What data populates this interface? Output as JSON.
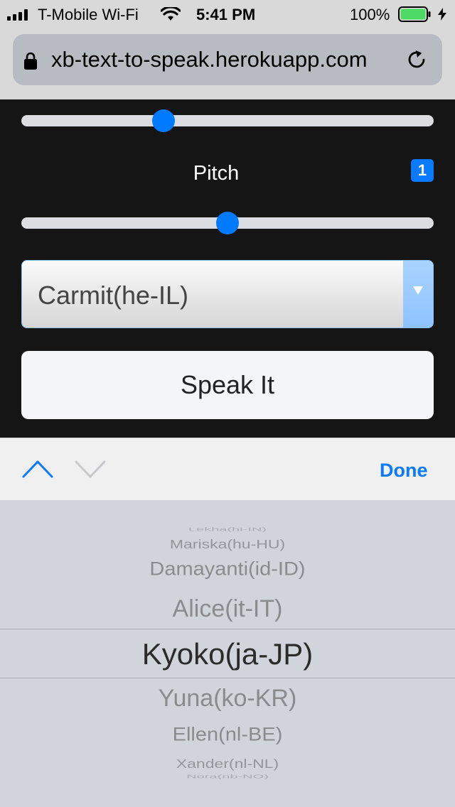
{
  "status_bar": {
    "carrier": "T-Mobile Wi-Fi",
    "time": "5:41 PM",
    "battery": "100%",
    "battery_color": "#4cd964"
  },
  "browser": {
    "url": "xb-text-to-speak.herokuapp.com",
    "icons": [
      "lock-icon",
      "reload-icon"
    ]
  },
  "controls": {
    "rate_slider_fraction": 0.345,
    "pitch_label": "Pitch",
    "pitch_slider_fraction": 0.5,
    "badge": "1",
    "voice_select_value": "Carmit(he-IL)",
    "speak_button": "Speak It",
    "accent_color": "#007aff"
  },
  "keyboard_toolbar": {
    "done_label": "Done",
    "icons": [
      "chevron-up-icon",
      "chevron-down-icon"
    ]
  },
  "picker": {
    "items": [
      "Lekha(hi-IN)",
      "Mariska(hu-HU)",
      "Damayanti(id-ID)",
      "Alice(it-IT)",
      "Kyoko(ja-JP)",
      "Yuna(ko-KR)",
      "Ellen(nl-BE)",
      "Xander(nl-NL)",
      "Nora(nb-NO)"
    ],
    "selected": "Kyoko(ja-JP)"
  }
}
